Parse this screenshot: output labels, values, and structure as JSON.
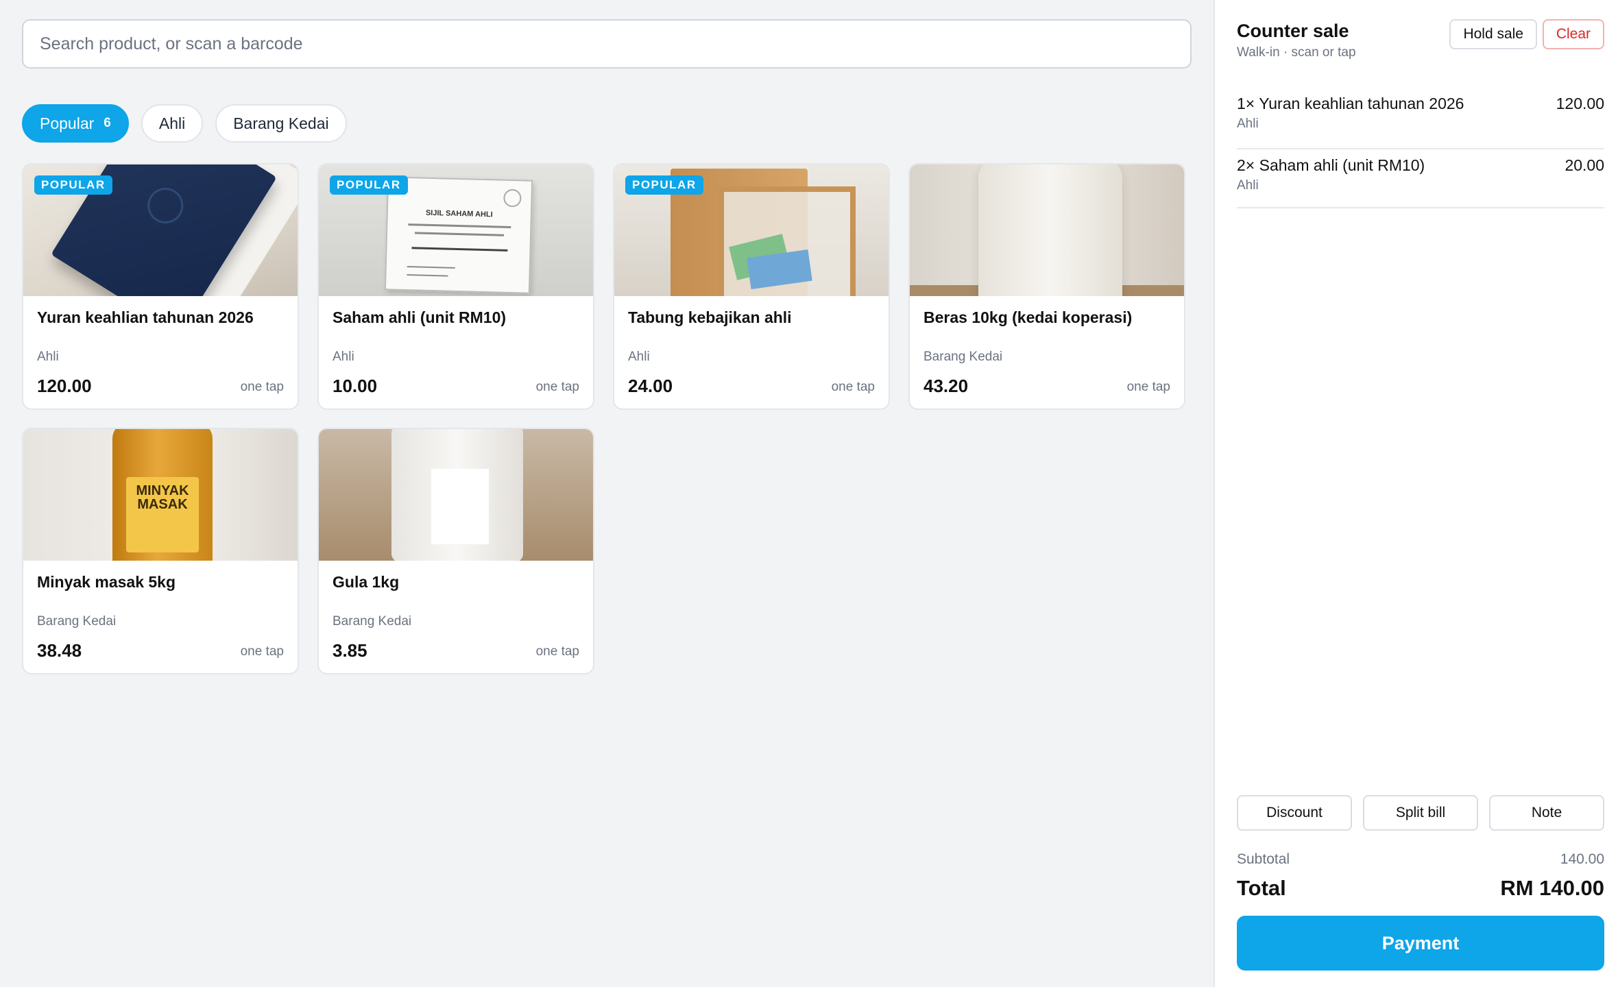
{
  "search": {
    "placeholder": "Search product, or scan a barcode"
  },
  "filters": [
    {
      "label": "Popular",
      "count": "6"
    },
    {
      "label": "Ahli"
    },
    {
      "label": "Barang Kedai"
    }
  ],
  "products": [
    {
      "name": "Yuran keahlian tahunan 2026",
      "category": "Ahli",
      "price": "120.00",
      "badge": "POPULAR",
      "hint": "one tap"
    },
    {
      "name": "Saham ahli (unit RM10)",
      "category": "Ahli",
      "price": "10.00",
      "badge": "POPULAR",
      "hint": "one tap"
    },
    {
      "name": "Tabung kebajikan ahli",
      "category": "Ahli",
      "price": "24.00",
      "badge": "POPULAR",
      "hint": "one tap"
    },
    {
      "name": "Beras 10kg (kedai koperasi)",
      "category": "Barang Kedai",
      "price": "43.20",
      "hint": "one tap"
    },
    {
      "name": "Minyak masak 5kg",
      "category": "Barang Kedai",
      "price": "38.48",
      "hint": "one tap"
    },
    {
      "name": "Gula 1kg",
      "category": "Barang Kedai",
      "price": "3.85",
      "hint": "one tap"
    }
  ],
  "product_art": {
    "certificate_title": "SIJIL SAHAM AHLI",
    "oil_label_line1": "MINYAK",
    "oil_label_line2": "MASAK"
  },
  "cart": {
    "title": "Counter sale",
    "subtitle": "Walk-in · scan or tap",
    "hold_label": "Hold sale",
    "clear_label": "Clear",
    "items": [
      {
        "desc": "1× Yuran keahlian tahunan 2026",
        "category": "Ahli",
        "amount": "120.00"
      },
      {
        "desc": "2× Saham ahli (unit RM10)",
        "category": "Ahli",
        "amount": "20.00"
      }
    ],
    "actions": {
      "discount": "Discount",
      "split": "Split bill",
      "note": "Note"
    },
    "subtotal_label": "Subtotal",
    "subtotal_value": "140.00",
    "total_label": "Total",
    "total_value": "RM 140.00",
    "payment_label": "Payment"
  },
  "colors": {
    "accent": "#0ea5e9",
    "danger": "#dc2626"
  }
}
